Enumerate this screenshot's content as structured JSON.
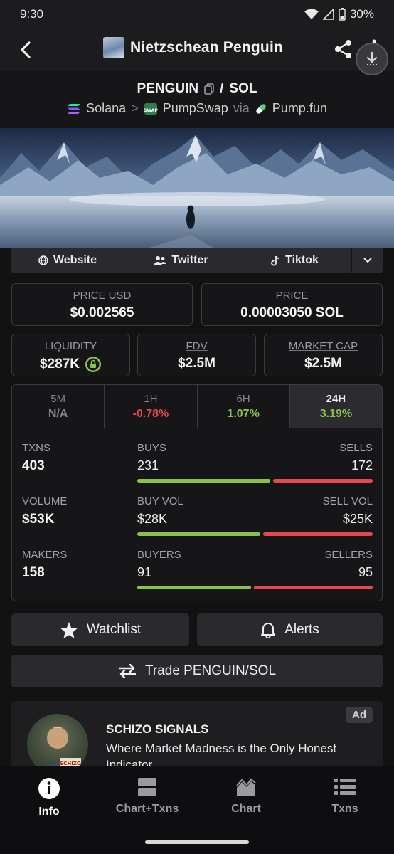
{
  "status_bar": {
    "time": "9:30",
    "battery": "30%"
  },
  "app_bar": {
    "title": "Nietzschean Penguin"
  },
  "pair": {
    "base": "PENGUIN",
    "separator": "/",
    "quote": "SOL"
  },
  "chain": {
    "network": "Solana",
    "chevron": ">",
    "dex": "PumpSwap",
    "via": "via",
    "launchpad": "Pump.fun"
  },
  "links": {
    "website": "Website",
    "twitter": "Twitter",
    "tiktok": "Tiktok"
  },
  "price": {
    "usd_label": "PRICE USD",
    "usd_value": "$0.002565",
    "native_label": "PRICE",
    "native_value": "0.00003050 SOL"
  },
  "metrics": {
    "liquidity_label": "LIQUIDITY",
    "liquidity_value": "$287K",
    "fdv_label": "FDV",
    "fdv_value": "$2.5M",
    "mcap_label": "MARKET CAP",
    "mcap_value": "$2.5M"
  },
  "timeframes": [
    {
      "label": "5M",
      "value": "N/A",
      "color": "#85858b"
    },
    {
      "label": "1H",
      "value": "-0.78%",
      "color": "#e5484d"
    },
    {
      "label": "6H",
      "value": "1.07%",
      "color": "#8bc34a"
    },
    {
      "label": "24H",
      "value": "3.19%",
      "color": "#8bc34a"
    }
  ],
  "stats": {
    "txns": {
      "label": "TXNS",
      "value": "403",
      "left_label": "BUYS",
      "left_value": "231",
      "right_label": "SELLS",
      "right_value": "172",
      "buy_fraction": 0.57
    },
    "volume": {
      "label": "VOLUME",
      "value": "$53K",
      "left_label": "BUY VOL",
      "left_value": "$28K",
      "right_label": "SELL VOL",
      "right_value": "$25K",
      "buy_fraction": 0.53
    },
    "makers": {
      "label": "MAKERS",
      "value": "158",
      "left_label": "BUYERS",
      "left_value": "91",
      "right_label": "SELLERS",
      "right_value": "95",
      "buy_fraction": 0.49
    }
  },
  "actions": {
    "watchlist": "Watchlist",
    "alerts": "Alerts",
    "trade": "Trade PENGUIN/SOL"
  },
  "ad": {
    "badge": "Ad",
    "title": "SCHIZO SIGNALS",
    "text": "Where Market Madness is the Only Honest Indicator.",
    "avatar_sign": "SCHIZO"
  },
  "nav": {
    "info": "Info",
    "chart_txns": "Chart+Txns",
    "chart": "Chart",
    "txns": "Txns"
  },
  "colors": {
    "green": "#8bc34a",
    "red": "#e5484d",
    "background": "#121212"
  }
}
